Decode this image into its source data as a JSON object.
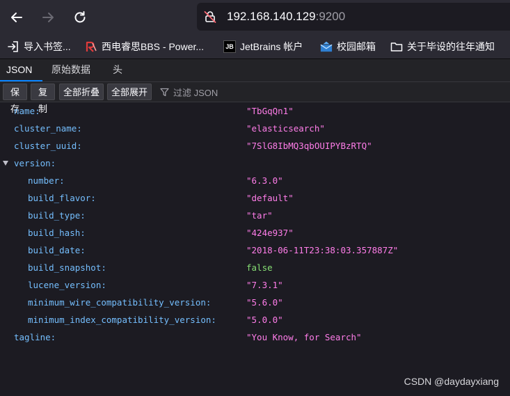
{
  "browser": {
    "url_host": "192.168.140.129",
    "url_port": ":9200"
  },
  "bookmarks": [
    {
      "label": "导入书签...",
      "icon": "import-icon"
    },
    {
      "label": "西电睿思BBS - Power...",
      "icon": "rs-logo-icon"
    },
    {
      "label": "JetBrains 帐户",
      "icon": "jetbrains-logo-icon",
      "icon_text": "JB"
    },
    {
      "label": "校园邮箱",
      "icon": "mail-icon"
    },
    {
      "label": "关于毕设的往年通知",
      "icon": "folder-icon"
    }
  ],
  "tabs": [
    {
      "label": "JSON",
      "active": true
    },
    {
      "label": "原始数据",
      "active": false
    },
    {
      "label": "头",
      "active": false
    }
  ],
  "actions": {
    "save": "保存",
    "copy": "复制",
    "collapse_all": "全部折叠",
    "expand_all": "全部展开",
    "filter_placeholder": "过滤 JSON"
  },
  "json": {
    "name": {
      "key": "name:",
      "value": "\"TbGqQn1\""
    },
    "cluster_name": {
      "key": "cluster_name:",
      "value": "\"elasticsearch\""
    },
    "cluster_uuid": {
      "key": "cluster_uuid:",
      "value": "\"7SlG8IbMQ3qbOUIPYBzRTQ\""
    },
    "version": {
      "key": "version:"
    },
    "number": {
      "key": "number:",
      "value": "\"6.3.0\""
    },
    "build_flavor": {
      "key": "build_flavor:",
      "value": "\"default\""
    },
    "build_type": {
      "key": "build_type:",
      "value": "\"tar\""
    },
    "build_hash": {
      "key": "build_hash:",
      "value": "\"424e937\""
    },
    "build_date": {
      "key": "build_date:",
      "value": "\"2018-06-11T23:38:03.357887Z\""
    },
    "build_snapshot": {
      "key": "build_snapshot:",
      "value": "false"
    },
    "lucene_version": {
      "key": "lucene_version:",
      "value": "\"7.3.1\""
    },
    "min_wire": {
      "key": "minimum_wire_compatibility_version:",
      "value": "\"5.6.0\""
    },
    "min_index": {
      "key": "minimum_index_compatibility_version:",
      "value": "\"5.0.0\""
    },
    "tagline": {
      "key": "tagline:",
      "value": "\"You Know, for Search\""
    }
  },
  "watermark": "CSDN @daydayxiang",
  "colors": {
    "key": "#75bfff",
    "string": "#ff7de9",
    "boolean": "#86de74",
    "accent": "#0a84ff"
  }
}
